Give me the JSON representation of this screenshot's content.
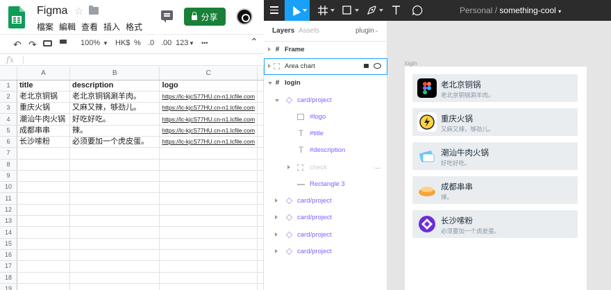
{
  "sheets": {
    "title": "Figma",
    "menu": [
      "檔案",
      "編輯",
      "查看",
      "插入",
      "格式"
    ],
    "share_label": "分享",
    "toolbar": {
      "zoom": "100%",
      "currency": "HK$",
      "percent": "%",
      "dec_less": ".0",
      "dec_more": ".00",
      "format": "123",
      "more": "•••"
    },
    "fx": "fx",
    "col_headers": [
      "A",
      "B",
      "C"
    ],
    "rows": [
      [
        "title",
        "description",
        "logo"
      ],
      [
        "老北京铜锅",
        "老北京铜锅涮羊肉。",
        "https://lc-kjcS77HU.cn-n1.lcfile.com"
      ],
      [
        "重庆火锅",
        "又麻又辣，够劲儿。",
        "https://lc-kjcS77HU.cn-n1.lcfile.com"
      ],
      [
        "潮汕牛肉火锅",
        "好吃好吃。",
        "https://lc-kjcS77HU.cn-n1.lcfile.com"
      ],
      [
        "成都串串",
        "辣。",
        "https://lc-kjcS77HU.cn-n1.lcfile.com"
      ],
      [
        "长沙嗦粉",
        "必须要加一个虎皮蛋。",
        "https://lc-kjcS77HU.cn-n1.lcfile.com"
      ]
    ],
    "row_numbers": [
      "1",
      "2",
      "3",
      "4",
      "5",
      "6",
      "7",
      "8",
      "9",
      "10",
      "11",
      "12",
      "13",
      "14",
      "15",
      "16",
      "17",
      "18",
      "19"
    ]
  },
  "figma": {
    "path_team": "Personal",
    "path_sep": "/",
    "path_file": "something-cool",
    "tabs": {
      "layers": "Layers",
      "assets": "Assets",
      "page": "plugin"
    },
    "layers": [
      {
        "label": "Frame",
        "icon": "#"
      },
      {
        "label": "Area chart",
        "icon": "frame"
      },
      {
        "label": "login",
        "icon": "#"
      },
      {
        "label": "card/project",
        "icon": "component"
      },
      {
        "label": "#logo",
        "icon": "image"
      },
      {
        "label": "#title",
        "icon": "T"
      },
      {
        "label": "#description",
        "icon": "T"
      },
      {
        "label": "check",
        "icon": "frame"
      },
      {
        "label": "Rectangle 3",
        "icon": "rect"
      },
      {
        "label": "card/project",
        "icon": "component"
      },
      {
        "label": "card/project",
        "icon": "component"
      },
      {
        "label": "card/project",
        "icon": "component"
      },
      {
        "label": "card/project",
        "icon": "component"
      }
    ],
    "frame_label": "login",
    "cards": [
      {
        "title": "老北京铜锅",
        "desc": "老北京铜锅涮羊肉。",
        "logo": "figma-logo",
        "color": "#000000"
      },
      {
        "title": "重庆火锅",
        "desc": "又麻又辣，够劲儿。",
        "logo": "lightning-logo",
        "color": "#ffd23f"
      },
      {
        "title": "潮汕牛肉火锅",
        "desc": "好吃好吃。",
        "logo": "card-logo",
        "color": "#6ec6f5"
      },
      {
        "title": "成都串串",
        "desc": "辣。",
        "logo": "bun-logo",
        "color": "#f7a43c"
      },
      {
        "title": "长沙嗦粉",
        "desc": "必须要加一个虎皮蛋。",
        "logo": "diamond-logo",
        "color": "#6c2fd6"
      }
    ]
  }
}
